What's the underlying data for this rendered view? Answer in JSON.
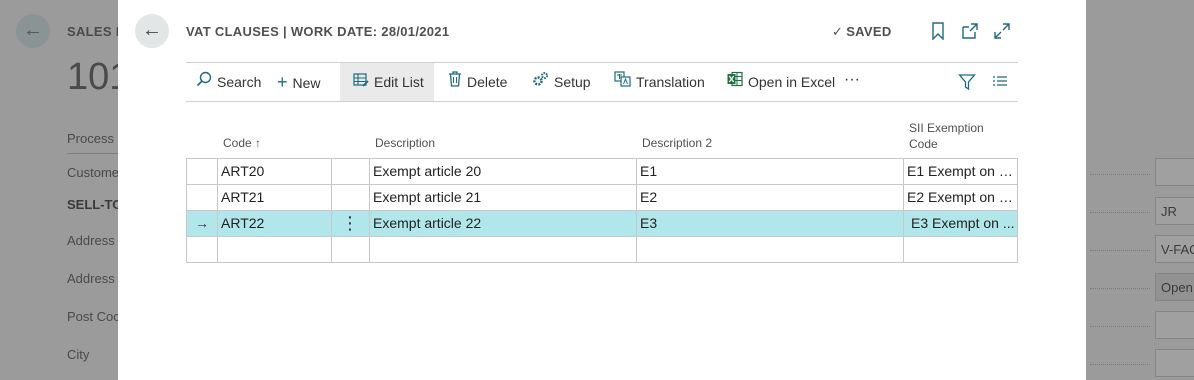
{
  "background": {
    "title": "SALES I",
    "number": "101",
    "tab_label": "Process",
    "fields": [
      {
        "label": "Custome"
      },
      {
        "label": "Address"
      },
      {
        "label": "Address"
      },
      {
        "label": "Post Coc"
      },
      {
        "label": "City"
      }
    ],
    "section": "SELL-TO",
    "right_values": [
      "",
      "JR",
      "V-FAC",
      "Open",
      "",
      ""
    ]
  },
  "dialog": {
    "title": "VAT CLAUSES | WORK DATE: 28/01/2021",
    "saved": "SAVED",
    "actions": {
      "search": "Search",
      "new": "New",
      "edit_list": "Edit List",
      "delete": "Delete",
      "setup": "Setup",
      "translation": "Translation",
      "open_in_excel": "Open in Excel",
      "more": "···"
    },
    "columns": {
      "code": "Code ↑",
      "description": "Description",
      "description2": "Description 2",
      "sii_line1": "SII Exemption",
      "sii_line2": "Code"
    },
    "rows": [
      {
        "code": "ART20",
        "description": "Exempt article 20",
        "description2": "E1",
        "sii": "E1 Exempt on a..."
      },
      {
        "code": "ART21",
        "description": "Exempt article 21",
        "description2": "E2",
        "sii": "E2 Exempt on a..."
      },
      {
        "code": "ART22",
        "description": "Exempt article 22",
        "description2": "E3",
        "sii": "E3 Exempt on ..."
      },
      {
        "code": "",
        "description": "",
        "description2": "",
        "sii": ""
      }
    ],
    "selected_row": 2
  }
}
